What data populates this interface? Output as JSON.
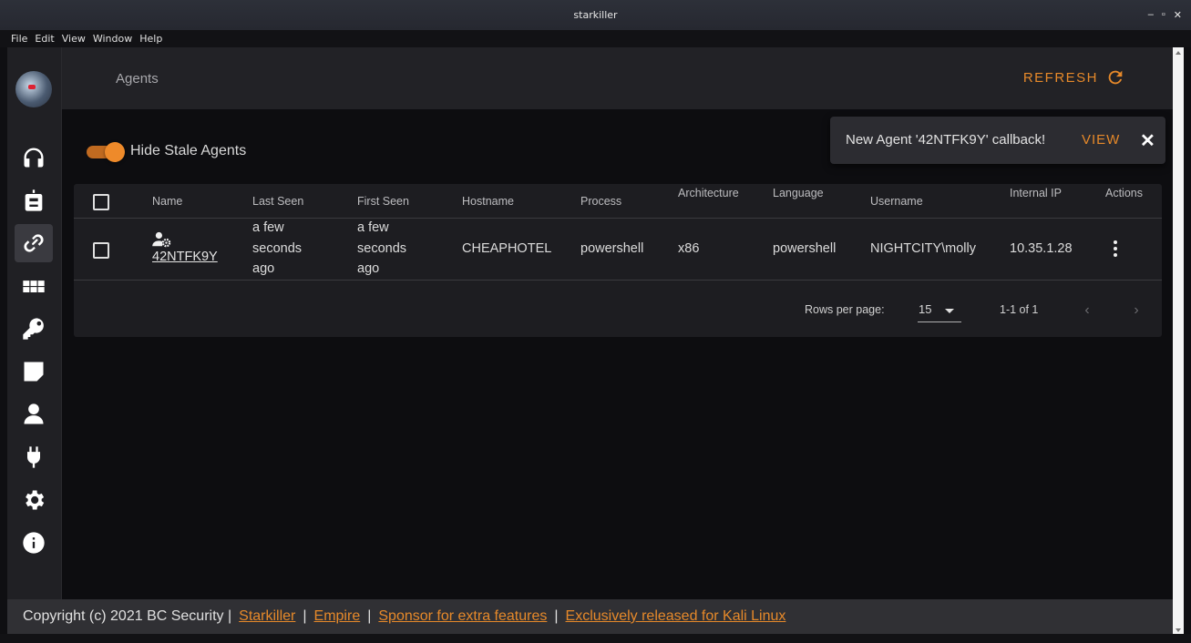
{
  "window": {
    "title": "starkiller",
    "controls": [
      "–",
      "▫",
      "✕"
    ]
  },
  "menu": [
    "File",
    "Edit",
    "View",
    "Window",
    "Help"
  ],
  "sidebar": {
    "items": [
      {
        "icon": "headphones-icon",
        "active": false
      },
      {
        "icon": "robot-icon",
        "active": false
      },
      {
        "icon": "link-icon",
        "active": true
      },
      {
        "icon": "grid-icon",
        "active": false
      },
      {
        "icon": "key-icon",
        "active": false
      },
      {
        "icon": "sticky-note-icon",
        "active": false
      },
      {
        "icon": "user-icon",
        "active": false
      },
      {
        "icon": "plug-icon",
        "active": false
      },
      {
        "icon": "gear-icon",
        "active": false
      },
      {
        "icon": "info-icon",
        "active": false
      }
    ]
  },
  "header": {
    "title": "Agents",
    "refresh_label": "REFRESH"
  },
  "toggle": {
    "label": "Hide Stale Agents",
    "on": true
  },
  "snackbar": {
    "message": "New Agent '42NTFK9Y' callback!",
    "action": "VIEW",
    "close": "✕"
  },
  "table": {
    "columns": [
      "Name",
      "Last Seen",
      "First Seen",
      "Hostname",
      "Process",
      "Architecture",
      "Language",
      "Username",
      "Internal IP",
      "Actions"
    ],
    "rows": [
      {
        "name": "42NTFK9Y",
        "last_seen": [
          "a few",
          "seconds",
          "ago"
        ],
        "first_seen": [
          "a few",
          "seconds",
          "ago"
        ],
        "hostname": "CHEAPHOTEL",
        "process": "powershell",
        "architecture": "x86",
        "language": "powershell",
        "username": "NIGHTCITY\\molly",
        "internal_ip": "10.35.1.28"
      }
    ],
    "footer": {
      "rows_per_page_label": "Rows per page:",
      "rows_per_page": "15",
      "range": "1-1 of 1",
      "prev": "‹",
      "next": "›"
    }
  },
  "footer": {
    "copyright": "Copyright (c) 2021 BC Security |",
    "links": [
      "Starkiller",
      "Empire",
      "Sponsor for extra features",
      "Exclusively released for Kali Linux"
    ],
    "separator": "|"
  },
  "colors": {
    "accent": "#e6892a",
    "background": "#0d0d10",
    "card": "#1d1d21",
    "sidebar": "#202024"
  }
}
